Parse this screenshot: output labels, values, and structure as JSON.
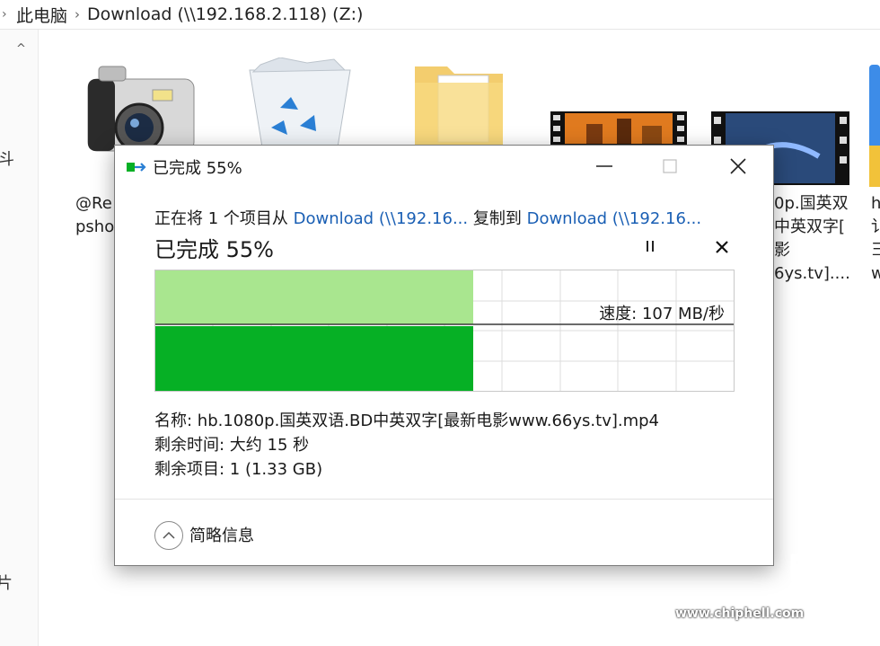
{
  "explorer": {
    "breadcrumb": {
      "root": "此电脑",
      "separator": "›",
      "current": "Download (\\\\192.168.2.118) (Z:)"
    },
    "left_pane": {
      "scroll_up": "^",
      "fragment_1": "斗",
      "fragment_2": "片"
    },
    "files": [
      {
        "icon": "camera-icon",
        "label_line1": "@Re",
        "label_line2": "psho"
      },
      {
        "icon": "recycle-bin-icon"
      },
      {
        "icon": "folder-icon"
      },
      {
        "icon": "video-thumbnail-icon"
      },
      {
        "icon": "video-thumbnail-icon",
        "label_line1": "0p.国英双",
        "label_line2": "中英双字[",
        "label_line3": "影",
        "label_line4": "6ys.tv]...."
      },
      {
        "icon": "app-icon",
        "label_line1": "h",
        "label_line2": "讠",
        "label_line3": "彐",
        "label_line4": "w"
      }
    ]
  },
  "dialog": {
    "title": "已完成 55%",
    "copy_prefix": "正在将 1 个项目从 ",
    "copy_source": "Download (\\\\192.16...",
    "copy_middle": " 复制到 ",
    "copy_dest": "Download (\\\\192.16...",
    "heading": "已完成 55%",
    "progress_percent": 55,
    "speed_text": "速度: 107 MB/秒",
    "name_line": "名称:  hb.1080p.国英双语.BD中英双字[最新电影www.66ys.tv].mp4",
    "time_line": "剩余时间: 大约 15 秒",
    "items_line": "剩余项目: 1 (1.33 GB)",
    "details_label": "简略信息",
    "colors": {
      "progress_light": "#a9e68f",
      "progress_dark": "#06b025",
      "link": "#1a5fb4"
    }
  },
  "watermark": {
    "url": "www.chiphell.com"
  }
}
